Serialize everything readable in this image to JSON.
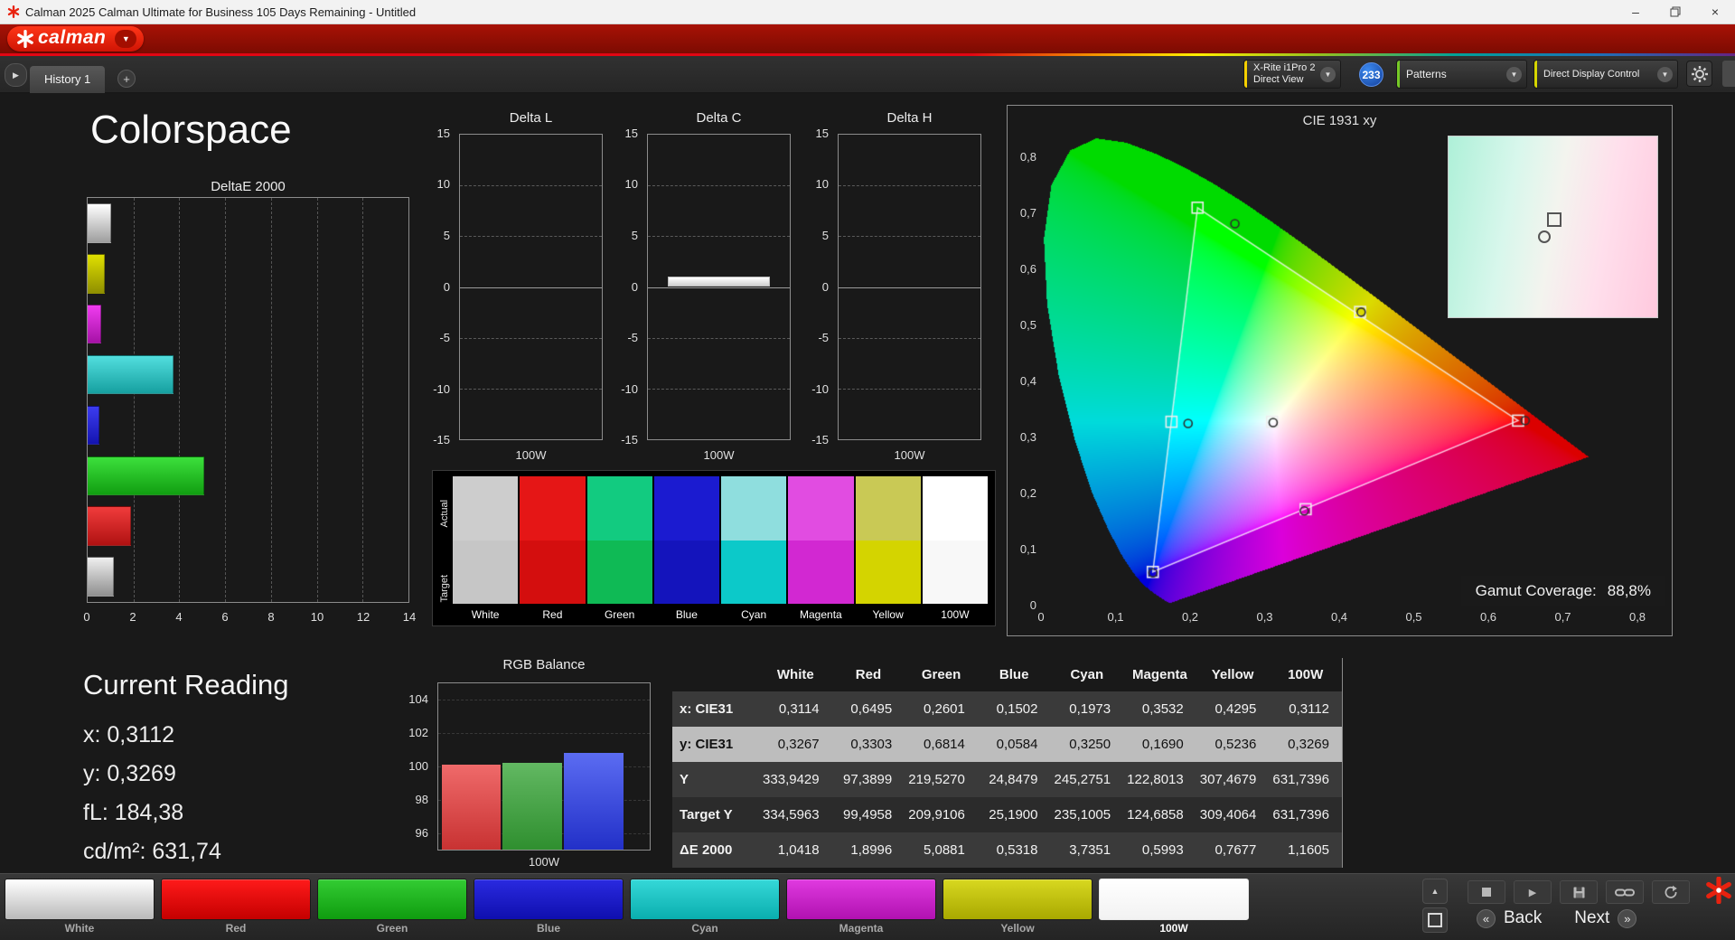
{
  "titlebar": {
    "title": "Calman 2025 Calman Ultimate for Business 105 Days Remaining  - Untitled",
    "minimize": "–",
    "close": "×"
  },
  "brand": {
    "logo_text": "calman",
    "accent": "#e8220f"
  },
  "tabs": {
    "history_tab": "History 1",
    "add_tab": "+"
  },
  "icons": {
    "play": "▶",
    "chevron_up": "▲",
    "expander": "▶",
    "caret_down": "▼"
  },
  "toolbar": {
    "meter_line1": "X-Rite i1Pro 2",
    "meter_line2": "Direct View",
    "badge": "233",
    "patterns_label": "Patterns",
    "display_control_label": "Direct Display Control"
  },
  "page": {
    "title": "Colorspace"
  },
  "current_reading": {
    "title": "Current Reading",
    "lines": [
      "x: 0,3112",
      "y: 0,3269",
      "fL: 184,38",
      "cd/m²: 631,74"
    ]
  },
  "gamut": {
    "label": "Gamut Coverage:",
    "value": "88,8%"
  },
  "nav": {
    "back": "Back",
    "next": "Next",
    "back_chevron": "«",
    "next_chevron": "»"
  },
  "swatch_strip": {
    "row_labels": [
      "Actual",
      "Target"
    ],
    "columns": [
      "White",
      "Red",
      "Green",
      "Blue",
      "Cyan",
      "Magenta",
      "Yellow",
      "100W"
    ],
    "actual_colors": [
      "#cdcdcd",
      "#e51616",
      "#12cb80",
      "#1b1bd0",
      "#8fdede",
      "#e14ce1",
      "#c9c955",
      "#ffffff"
    ],
    "target_colors": [
      "#c6c6c6",
      "#d40e0e",
      "#0fba55",
      "#1414bc",
      "#0cc9c9",
      "#d228d2",
      "#d4d400",
      "#f8f8f8"
    ]
  },
  "pattern_bar": {
    "buttons": [
      {
        "label": "White",
        "color1": "#ffffff",
        "color2": "#b9b9b9"
      },
      {
        "label": "Red",
        "color1": "#ff1a1a",
        "color2": "#c40000"
      },
      {
        "label": "Green",
        "color1": "#33cc33",
        "color2": "#0f9c0f"
      },
      {
        "label": "Blue",
        "color1": "#2a2ae0",
        "color2": "#0f0fae"
      },
      {
        "label": "Cyan",
        "color1": "#35d8d8",
        "color2": "#0aaeae"
      },
      {
        "label": "Magenta",
        "color1": "#e03ae0",
        "color2": "#b011b0"
      },
      {
        "label": "Yellow",
        "color1": "#d8d820",
        "color2": "#a8a800"
      },
      {
        "label": "100W",
        "color1": "#ffffff",
        "color2": "#f2f2f2",
        "selected": true
      }
    ]
  },
  "chart_data": [
    {
      "id": "deltaE",
      "type": "bar",
      "orientation": "horizontal",
      "title": "DeltaE 2000",
      "categories": [
        "White",
        "Yellow",
        "Magenta",
        "Cyan",
        "Blue",
        "Green",
        "Red",
        "100W"
      ],
      "values": [
        1.0418,
        0.7677,
        0.5993,
        3.7351,
        0.5318,
        5.0881,
        1.8996,
        1.1605
      ],
      "colors": [
        "#ffffff",
        "#e0e000",
        "#f03cf0",
        "#52dede",
        "#3c3cf0",
        "#3ce03c",
        "#f03c3c",
        "#efefef"
      ],
      "colors2": [
        "#9e9e9e",
        "#8f8f00",
        "#a612a6",
        "#16a0a0",
        "#1414b0",
        "#119e11",
        "#b01212",
        "#8f8f8f"
      ],
      "xlim": [
        0,
        14
      ],
      "xticks": [
        0,
        2,
        4,
        6,
        8,
        10,
        12,
        14
      ],
      "xlabel": ""
    },
    {
      "id": "deltaL",
      "type": "bar",
      "title": "Delta L",
      "categories": [
        "100W"
      ],
      "values": [
        0
      ],
      "ylim": [
        -15,
        15
      ],
      "yticks": [
        15,
        10,
        5,
        0,
        -5,
        -10,
        -15
      ],
      "xlabel": "100W"
    },
    {
      "id": "deltaC",
      "type": "bar",
      "title": "Delta C",
      "categories": [
        "100W"
      ],
      "values": [
        1.0
      ],
      "ylim": [
        -15,
        15
      ],
      "yticks": [
        15,
        10,
        5,
        0,
        -5,
        -10,
        -15
      ],
      "xlabel": "100W"
    },
    {
      "id": "deltaH",
      "type": "bar",
      "title": "Delta H",
      "categories": [
        "100W"
      ],
      "values": [
        0
      ],
      "ylim": [
        -15,
        15
      ],
      "yticks": [
        15,
        10,
        5,
        0,
        -5,
        -10,
        -15
      ],
      "xlabel": "100W"
    },
    {
      "id": "rgbBalance",
      "type": "bar",
      "title": "RGB Balance",
      "categories": [
        "Red",
        "Green",
        "Blue"
      ],
      "values": [
        100.1,
        100.2,
        100.8
      ],
      "colors": [
        "#ef6a6a",
        "#62b862",
        "#5b6cf2"
      ],
      "colors2": [
        "#c83232",
        "#2f8f2f",
        "#2230c8"
      ],
      "ylim": [
        95,
        105
      ],
      "yticks": [
        104,
        102,
        100,
        98,
        96
      ],
      "xlabel": "100W"
    },
    {
      "id": "cie",
      "type": "scatter",
      "title": "CIE 1931 xy",
      "xlim": [
        0,
        0.8
      ],
      "ylim": [
        0,
        0.85
      ],
      "xticks": [
        "0",
        "0,1",
        "0,2",
        "0,3",
        "0,4",
        "0,5",
        "0,6",
        "0,7",
        "0,8"
      ],
      "xtick_values": [
        0,
        0.1,
        0.2,
        0.3,
        0.4,
        0.5,
        0.6,
        0.7,
        0.8
      ],
      "yticks": [
        "0,8",
        "0,7",
        "0,6",
        "0,5",
        "0,4",
        "0,3",
        "0,2",
        "0,1",
        "0"
      ],
      "ytick_values": [
        0.8,
        0.7,
        0.6,
        0.5,
        0.4,
        0.3,
        0.2,
        0.1,
        0
      ],
      "target_triangle": [
        [
          0.64,
          0.33
        ],
        [
          0.21,
          0.71
        ],
        [
          0.15,
          0.06
        ]
      ],
      "target_points": [
        [
          0.31,
          0.328
        ],
        [
          0.64,
          0.33
        ],
        [
          0.21,
          0.71
        ],
        [
          0.15,
          0.06
        ],
        [
          0.175,
          0.328
        ],
        [
          0.355,
          0.172
        ],
        [
          0.428,
          0.524
        ]
      ],
      "measured_points": [
        [
          0.3114,
          0.3267
        ],
        [
          0.6495,
          0.3303
        ],
        [
          0.2601,
          0.6814
        ],
        [
          0.1502,
          0.0584
        ],
        [
          0.1973,
          0.325
        ],
        [
          0.3532,
          0.169
        ],
        [
          0.4295,
          0.5236
        ]
      ]
    },
    {
      "id": "measurements",
      "type": "table",
      "columns": [
        "White",
        "Red",
        "Green",
        "Blue",
        "Cyan",
        "Magenta",
        "Yellow",
        "100W"
      ],
      "rows": [
        {
          "label": "x: CIE31",
          "values": [
            "0,3114",
            "0,6495",
            "0,2601",
            "0,1502",
            "0,1973",
            "0,3532",
            "0,4295",
            "0,3112"
          ]
        },
        {
          "label": "y: CIE31",
          "highlighted": true,
          "values": [
            "0,3267",
            "0,3303",
            "0,6814",
            "0,0584",
            "0,3250",
            "0,1690",
            "0,5236",
            "0,3269"
          ]
        },
        {
          "label": "Y",
          "values": [
            "333,9429",
            "97,3899",
            "219,5270",
            "24,8479",
            "245,2751",
            "122,8013",
            "307,4679",
            "631,7396"
          ]
        },
        {
          "label": "Target Y",
          "values": [
            "334,5963",
            "99,4958",
            "209,9106",
            "25,1900",
            "235,1005",
            "124,6858",
            "309,4064",
            "631,7396"
          ]
        },
        {
          "label": "ΔE 2000",
          "values": [
            "1,0418",
            "1,8996",
            "5,0881",
            "0,5318",
            "3,7351",
            "0,5993",
            "0,7677",
            "1,1605"
          ]
        }
      ]
    }
  ]
}
